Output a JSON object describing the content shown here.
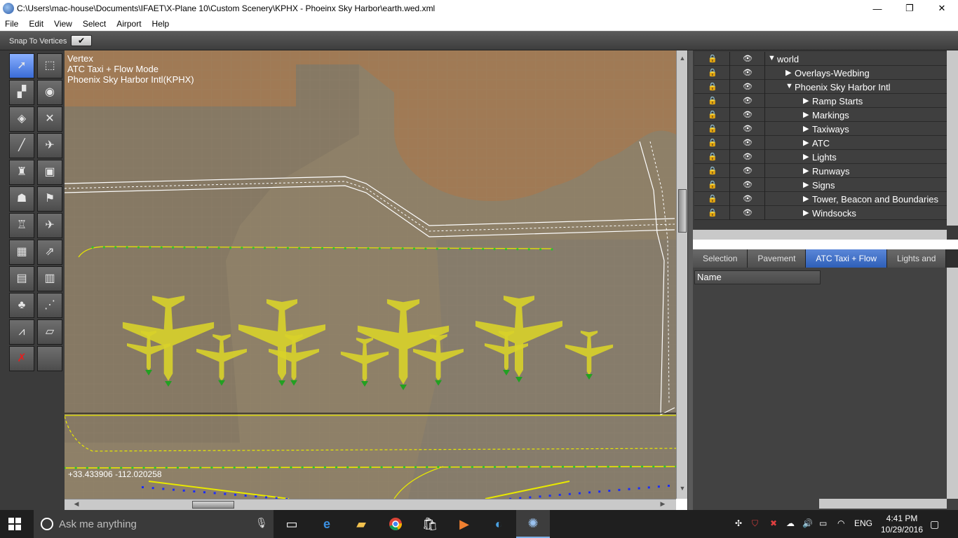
{
  "window": {
    "title": "C:\\Users\\mac-house\\Documents\\IFAET\\X-Plane 10\\Custom Scenery\\KPHX - Phoeinx Sky Harbor\\earth.wed.xml",
    "minimize": "—",
    "restore": "❐",
    "close": "✕"
  },
  "menu": [
    "File",
    "Edit",
    "View",
    "Select",
    "Airport",
    "Help"
  ],
  "options": {
    "snap_label": "Snap To Vertices",
    "snap_checked": "✔"
  },
  "map": {
    "info_lines": [
      "Vertex",
      "ATC Taxi + Flow Mode",
      "Phoenix Sky Harbor Intl(KPHX)"
    ],
    "coordinates": "+33.433906 -112.020258"
  },
  "hierarchy": {
    "rows": [
      {
        "expand": "▼",
        "label": "world"
      },
      {
        "expand": "▶",
        "label": "Overlays-Wedbing"
      },
      {
        "expand": "▼",
        "label": "Phoenix Sky Harbor Intl"
      },
      {
        "expand": "▶",
        "label": "Ramp Starts"
      },
      {
        "expand": "▶",
        "label": "Markings"
      },
      {
        "expand": "▶",
        "label": "Taxiways"
      },
      {
        "expand": "▶",
        "label": "ATC"
      },
      {
        "expand": "▶",
        "label": "Lights"
      },
      {
        "expand": "▶",
        "label": "Runways"
      },
      {
        "expand": "▶",
        "label": "Signs"
      },
      {
        "expand": "▶",
        "label": "Tower, Beacon and Boundaries"
      },
      {
        "expand": "▶",
        "label": "Windsocks"
      }
    ]
  },
  "tabs": [
    "Selection",
    "Pavement",
    "ATC Taxi + Flow",
    "Lights and"
  ],
  "props": {
    "column_header": "Name"
  },
  "taskbar": {
    "search_placeholder": "Ask me anything",
    "language": "ENG",
    "time": "4:41 PM",
    "date": "10/29/2016"
  },
  "colors": {
    "accent": "#3a6cd6",
    "map_ground": "#8e8068",
    "terminal": "#a07a55",
    "taxi_line": "#e8e800",
    "aircraft": "#d8d12a"
  }
}
